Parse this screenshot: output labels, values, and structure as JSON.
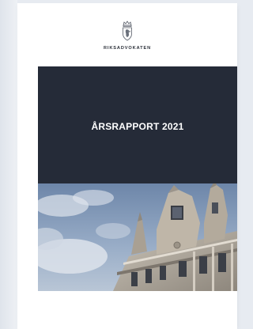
{
  "org": {
    "name": "RIKSADVOKATEN",
    "logo_icon": "coat-of-arms-icon"
  },
  "cover": {
    "title": "ÅRSRAPPORT 2021",
    "photo": "historic-building-facade"
  },
  "colors": {
    "title_block": "#252b38",
    "page": "#ffffff",
    "background": "#e7ebf1",
    "sky": "#8fa3bf"
  }
}
